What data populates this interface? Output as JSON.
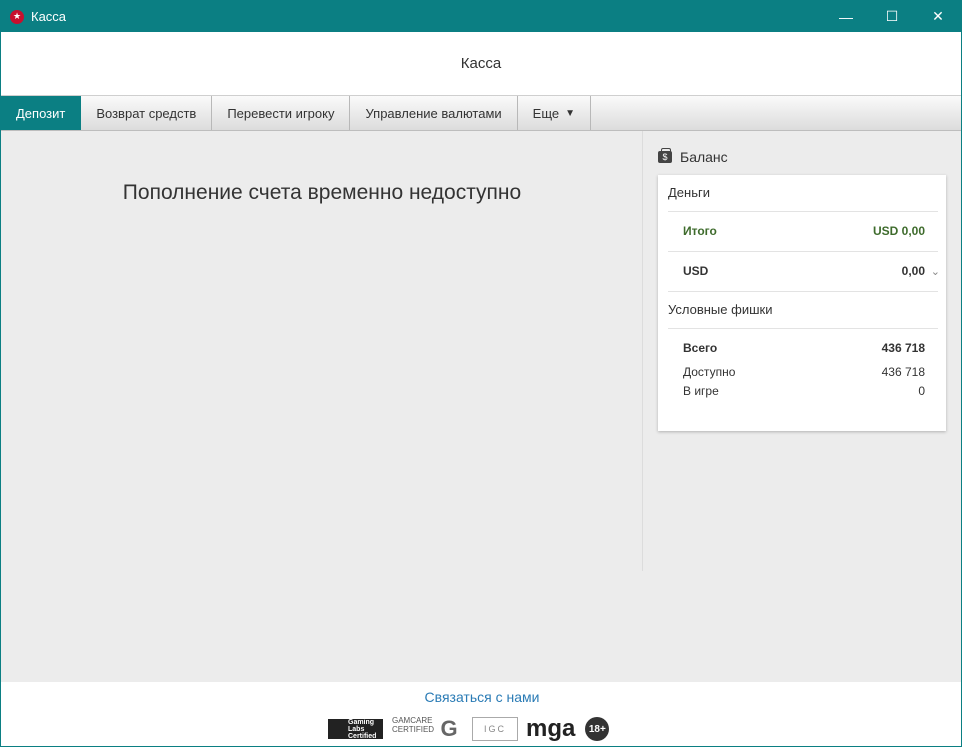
{
  "window": {
    "title": "Касса",
    "app_icon_glyph": "★"
  },
  "controls": {
    "minimize": "—",
    "maximize": "☐",
    "close": "✕"
  },
  "header": {
    "title": "Касса"
  },
  "tabs": [
    {
      "label": "Депозит",
      "active": true
    },
    {
      "label": "Возврат средств"
    },
    {
      "label": "Перевести игроку"
    },
    {
      "label": "Управление валютами"
    },
    {
      "label": "Еще",
      "caret": "▼"
    }
  ],
  "main": {
    "message": "Пополнение счета временно недоступно"
  },
  "balance": {
    "title": "Баланс",
    "icon": "wallet-icon",
    "money": {
      "title": "Деньги",
      "total_label": "Итого",
      "total_value": "USD 0,00",
      "currency_label": "USD",
      "currency_value": "0,00"
    },
    "chips": {
      "title": "Условные фишки",
      "total_label": "Всего",
      "total_value": "436 718",
      "available_label": "Доступно",
      "available_value": "436 718",
      "in_game_label": "В игре",
      "in_game_value": "0"
    }
  },
  "footer": {
    "contact": "Связаться с нами",
    "logos": {
      "gli": "Gaming Labs Certified",
      "gamcare": "GAMCARE CERTIFIED",
      "gamcare_small": "GAMCARE",
      "igc": "IGC",
      "mga": "mga",
      "age": "18+"
    }
  },
  "colors": {
    "accent": "#0b7f83",
    "link": "#2a7bb5",
    "positive": "#3e6b2c",
    "brand_red": "#c8102e"
  }
}
